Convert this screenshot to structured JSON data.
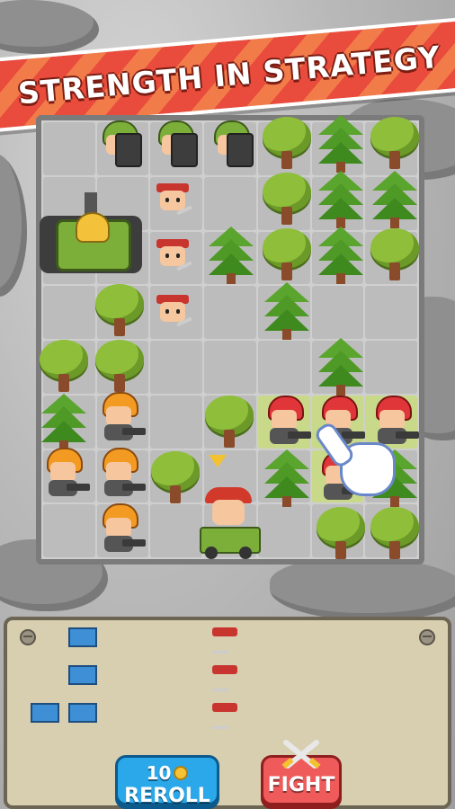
{
  "banner": {
    "title": "STRENGTH IN STRATEGY"
  },
  "buttons": {
    "reroll": {
      "cost": "10",
      "label": "REROLL",
      "icon": "coin-icon"
    },
    "fight": {
      "label": "FIGHT",
      "icon": "crossed-swords-icon"
    }
  },
  "colors": {
    "banner_red": "#e94b3c",
    "reroll_blue": "#2aa8ea",
    "fight_red": "#ef5b5b",
    "player_green": "#7cae3a",
    "player_orange": "#f39a22",
    "enemy_red": "#e0363a",
    "bench_blue": "#3e8fd6"
  },
  "bench": {
    "units": [
      {
        "type": "blue-helmet-gunner"
      },
      {
        "type": "blue-helmet-gunner"
      },
      {
        "type": "blue-helmet-gunner"
      },
      {
        "type": "blue-helmet-gunner"
      },
      {
        "type": "red-bandana-knife"
      },
      {
        "type": "red-bandana-knife"
      },
      {
        "type": "red-bandana-knife"
      }
    ]
  }
}
